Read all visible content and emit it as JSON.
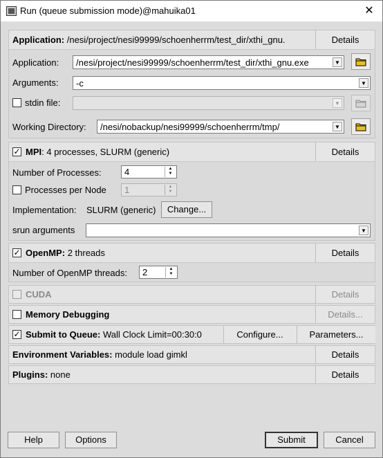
{
  "window": {
    "title": "Run (queue submission mode)@mahuika01",
    "close": "✕"
  },
  "application": {
    "header_label": "Application:",
    "header_value": "/nesi/project/nesi99999/schoenherrm/test_dir/xthi_gnu.",
    "details": "Details",
    "app_label": "Application:",
    "app_value": "/nesi/project/nesi99999/schoenherrm/test_dir/xthi_gnu.exe",
    "args_label": "Arguments:",
    "args_value": "-c",
    "stdin_label": "stdin file:",
    "stdin_value": "",
    "workdir_label": "Working Directory:",
    "workdir_value": "/nesi/nobackup/nesi99999/schoenherrm/tmp/"
  },
  "mpi": {
    "label": "MPI",
    "summary": ": 4 processes, SLURM (generic)",
    "checked": true,
    "details": "Details",
    "nprocs_label": "Number of Processes:",
    "nprocs_value": "4",
    "ppn_label": "Processes per Node",
    "ppn_value": "1",
    "impl_label": "Implementation:",
    "impl_value": "SLURM (generic)",
    "change": "Change...",
    "srun_label": "srun arguments",
    "srun_value": ""
  },
  "openmp": {
    "label": "OpenMP:",
    "summary": "2 threads",
    "checked": true,
    "details": "Details",
    "threads_label": "Number of OpenMP threads:",
    "threads_value": "2"
  },
  "cuda": {
    "label": "CUDA",
    "details": "Details"
  },
  "memdebug": {
    "label": "Memory Debugging",
    "details": "Details..."
  },
  "queue": {
    "label": "Submit to Queue:",
    "summary": "Wall Clock Limit=00:30:0",
    "checked": true,
    "configure": "Configure...",
    "parameters": "Parameters..."
  },
  "env": {
    "label": "Environment Variables:",
    "value": "module load gimkl",
    "details": "Details"
  },
  "plugins": {
    "label": "Plugins:",
    "value": "none",
    "details": "Details"
  },
  "footer": {
    "help": "Help",
    "options": "Options",
    "submit": "Submit",
    "cancel": "Cancel"
  }
}
